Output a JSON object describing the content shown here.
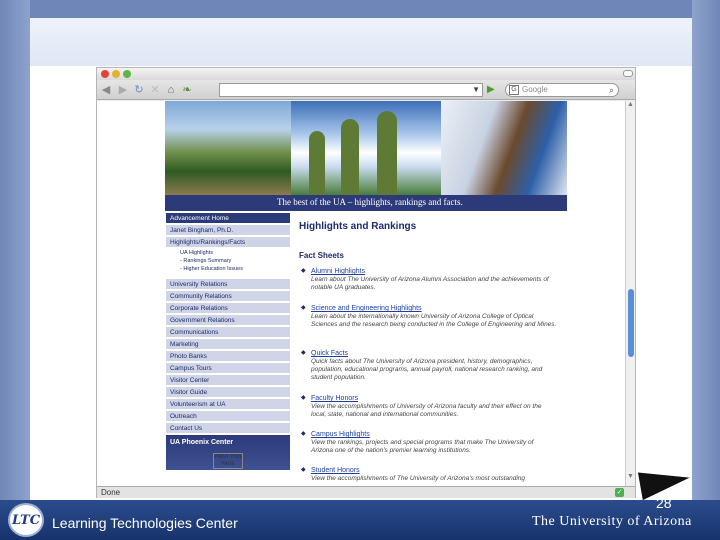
{
  "slide": {
    "org_name": "Learning Technologies Center",
    "org_logo_text": "LTC",
    "university_name": "The University of Arizona",
    "slide_number": "28"
  },
  "browser": {
    "url": "",
    "search_placeholder": "Google",
    "status_text": "Done"
  },
  "page": {
    "tagline": "The best of the UA – highlights, rankings and facts.",
    "nav": [
      "Advancement Home",
      "Janet Bingham, Ph.D.",
      "Highlights/Rankings/Facts"
    ],
    "nav_sub": [
      "UA Highlights",
      "- Rankings Summary",
      "- Higher Education Issues"
    ],
    "nav_more": [
      "University Relations",
      "Community Relations",
      "Corporate Relations",
      "Government Relations",
      "Communications",
      "Marketing",
      "Photo Banks",
      "Campus Tours",
      "Visitor Center",
      "Visitor Guide",
      "Volunteerism at UA",
      "Outreach",
      "Contact Us"
    ],
    "phoenix_label": "UA Phoenix Center",
    "bottom_logo": "PRINT THIS PAGE",
    "heading": "Highlights and Rankings",
    "subheading": "Fact Sheets",
    "facts": [
      {
        "link": "Alumni Highlights",
        "desc": "Learn about The University of Arizona Alumni Association and the achievements of notable UA graduates."
      },
      {
        "link": "Science and Engineering Highlights",
        "desc": "Learn about the internationally known University of Arizona College of Optical Sciences and the research being conducted in the College of Engineering and Mines."
      },
      {
        "link": "Quick Facts",
        "desc": "Quick facts about The University of Arizona president, history, demographics, population, educational programs, annual payroll, national research ranking, and student population."
      },
      {
        "link": "Faculty Honors",
        "desc": "View the accomplishments of University of Arizona faculty and their effect on the local, state, national and international communities."
      },
      {
        "link": "Campus Highlights",
        "desc": "View the rankings, projects and special programs that make The University of Arizona one of the nation's premier learning institutions."
      },
      {
        "link": "Student Honors",
        "desc": "View the accomplishments of The University of Arizona's most outstanding"
      }
    ]
  }
}
